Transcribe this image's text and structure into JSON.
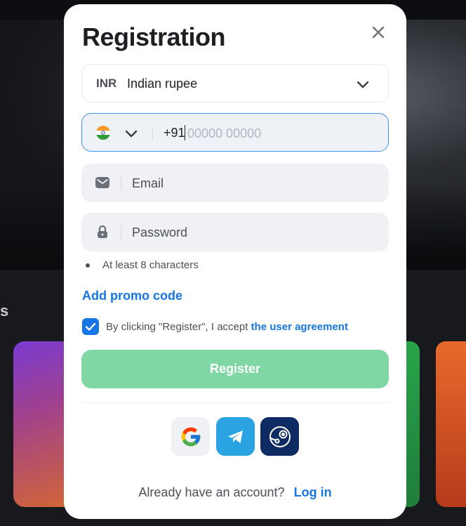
{
  "modal": {
    "title": "Registration",
    "close_icon": "close-icon"
  },
  "currency": {
    "code": "INR",
    "name": "Indian rupee",
    "chevron_icon": "chevron-down-icon"
  },
  "phone": {
    "flag_icon": "india-flag-icon",
    "prefix": "+91",
    "placeholder": "00000 00000",
    "value": ""
  },
  "email": {
    "icon": "envelope-icon",
    "placeholder": "Email"
  },
  "password": {
    "icon": "lock-icon",
    "placeholder": "Password",
    "hint": "At least 8 characters"
  },
  "promo": {
    "label": "Add promo code"
  },
  "agreement": {
    "checked": true,
    "text": "By clicking \"Register\", I accept",
    "link": "the user agreement"
  },
  "register": {
    "label": "Register"
  },
  "social": [
    {
      "name": "google-icon"
    },
    {
      "name": "telegram-icon"
    },
    {
      "name": "steam-icon"
    }
  ],
  "login": {
    "question": "Already have an account?",
    "link": "Log in"
  },
  "colors": {
    "accent": "#1776e6",
    "register_button": "#7fd8a4",
    "phone_border": "#3f8ff0",
    "field_bg": "#eff1f4",
    "telegram": "#2aa3e3",
    "steam": "#0f2b63"
  }
}
